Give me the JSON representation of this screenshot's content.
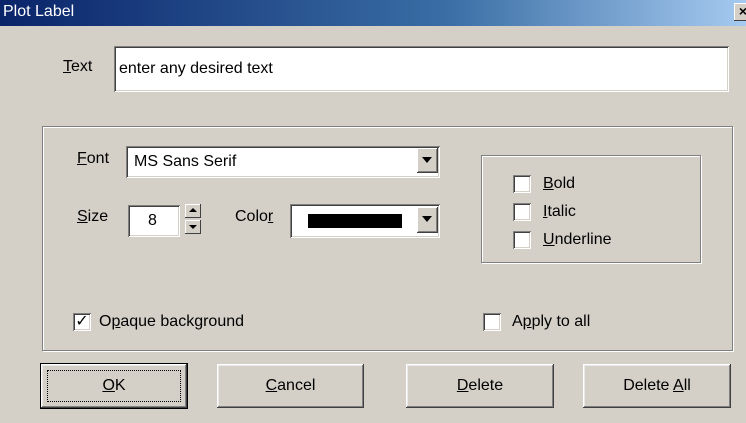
{
  "window": {
    "title": "Plot Label",
    "close_glyph": "×"
  },
  "text_field": {
    "label_mnemonic": "T",
    "label_rest": "ext",
    "value": "enter any desired text"
  },
  "font": {
    "label_mnemonic": "F",
    "label_rest": "ont",
    "value": "MS Sans Serif"
  },
  "size": {
    "label_mnemonic": "S",
    "label_rest": "ize",
    "value": "8"
  },
  "color": {
    "label_prefix": "Colo",
    "label_mnemonic": "r",
    "value": "#000000"
  },
  "style": {
    "bold": {
      "label_mnemonic": "B",
      "label_rest": "old",
      "checked": false
    },
    "italic": {
      "label_mnemonic": "I",
      "label_rest": "talic",
      "checked": false
    },
    "underline": {
      "label_mnemonic": "U",
      "label_rest": "nderline",
      "checked": false
    }
  },
  "opaque": {
    "label_prefix": "O",
    "label_mnemonic": "p",
    "label_rest": "aque background",
    "checked": true,
    "check_glyph": "✓"
  },
  "apply_all": {
    "label_prefix": "A",
    "label_mnemonic": "p",
    "label_rest": "ply to all",
    "checked": false
  },
  "buttons": {
    "ok": {
      "mnemonic": "O",
      "rest": "K"
    },
    "cancel": {
      "mnemonic": "C",
      "rest": "ancel"
    },
    "delete": {
      "mnemonic": "D",
      "rest": "elete"
    },
    "delete_all": {
      "prefix": "Delete ",
      "mnemonic": "A",
      "rest": "ll"
    }
  },
  "colors": {
    "title_start": "#0a246a",
    "title_end": "#a6caf0",
    "face": "#d4d0c8"
  }
}
